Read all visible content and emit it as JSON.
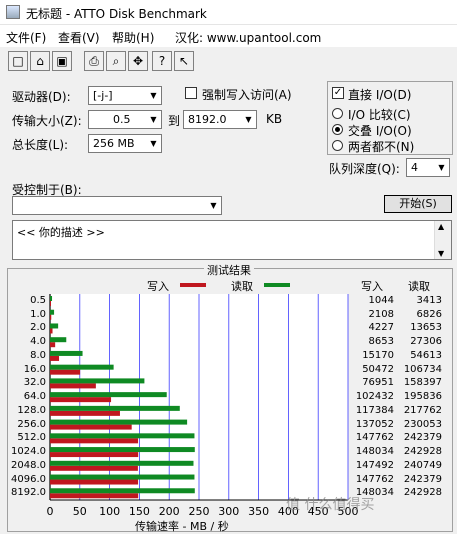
{
  "window": {
    "title": "无标题 - ATTO Disk Benchmark"
  },
  "menu": {
    "file": "文件(F)",
    "view": "查看(V)",
    "help": "帮助(H)",
    "sinicize": "汉化: www.upantool.com"
  },
  "toolbar_icons": [
    "new-icon",
    "open-icon",
    "save-icon",
    "print-icon",
    "print-preview-icon",
    "move-icon",
    "help-icon",
    "context-help-icon"
  ],
  "form": {
    "drive_label": "驱动器(D):",
    "drive_value": "[-j-]",
    "force_write_label": "强制写入访问(A)",
    "direct_io_label": "直接 I/O(D)",
    "transfer_label": "传输大小(Z):",
    "transfer_from": "0.5",
    "to_label": "到",
    "transfer_to": "8192.0",
    "kb_label": "KB",
    "total_label": "总长度(L):",
    "total_value": "256 MB",
    "io_compare": "I/O 比较(C)",
    "overlapped_io": "交叠 I/O(O)",
    "neither": "两者都不(N)",
    "queue_label": "队列深度(Q):",
    "queue_value": "4",
    "controlled_label": "受控制于(B):",
    "controlled_value": "",
    "start_button": "开始(S)",
    "description": "<<  你的描述  >>"
  },
  "results": {
    "title": "测试结果",
    "legend_write": "写入",
    "legend_read": "读取",
    "col_write": "写入",
    "col_read": "读取",
    "x_axis_title": "传输速率 - MB / 秒",
    "watermark": "值 什么值得买"
  },
  "colors": {
    "write": "#c0171f",
    "read": "#0f8a23"
  },
  "chart_data": {
    "type": "bar",
    "categories": [
      "0.5",
      "1.0",
      "2.0",
      "4.0",
      "8.0",
      "16.0",
      "32.0",
      "64.0",
      "128.0",
      "256.0",
      "512.0",
      "1024.0",
      "2048.0",
      "4096.0",
      "8192.0"
    ],
    "series": [
      {
        "name": "写入",
        "values": [
          1044,
          2108,
          4227,
          8653,
          15170,
          50472,
          76951,
          102432,
          117384,
          137052,
          147762,
          148034,
          147492,
          147762,
          148034
        ]
      },
      {
        "name": "读取",
        "values": [
          3413,
          6826,
          13653,
          27306,
          54613,
          106734,
          158397,
          195836,
          217762,
          230053,
          242379,
          242928,
          240749,
          242379,
          242928
        ]
      }
    ],
    "xlim": [
      0,
      500
    ],
    "xticks": [
      "0",
      "50",
      "100",
      "150",
      "200",
      "250",
      "300",
      "350",
      "400",
      "450",
      "500"
    ],
    "xlabel": "传输速率 - MB / 秒",
    "unit_divisor": 1000
  }
}
